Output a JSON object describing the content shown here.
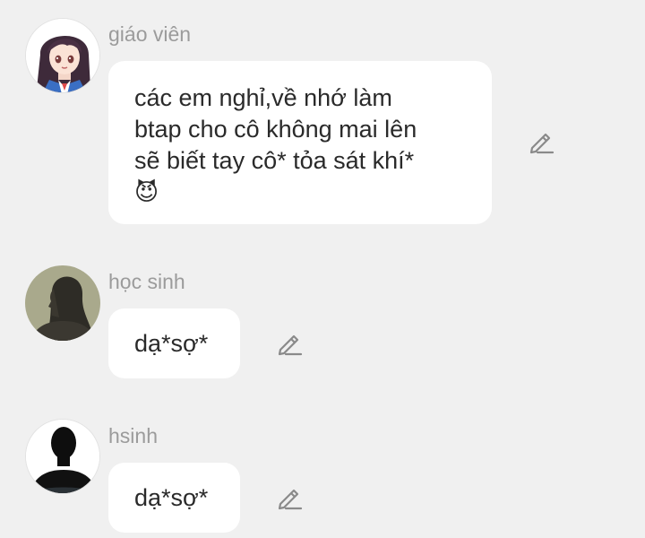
{
  "messages": [
    {
      "sender": "giáo viên",
      "avatar_icon": "anime-girl-avatar-icon",
      "lines": [
        "các em nghỉ,về nhớ làm",
        "btap cho cô không mai lên",
        "sẽ biết tay cô* tỏa sát khí*"
      ],
      "emoji": "😈"
    },
    {
      "sender": "học sinh",
      "avatar_icon": "silhouette-woman-avatar-icon",
      "lines": [
        "dạ*sợ*"
      ]
    },
    {
      "sender": "hsinh",
      "avatar_icon": "silhouette-man-avatar-icon",
      "lines": [
        "dạ*sợ*"
      ]
    }
  ],
  "icons": {
    "edit": "pencil-edit-icon"
  },
  "colors": {
    "background": "#f0f0f0",
    "bubble": "#ffffff",
    "sender_name": "#9b9b9b",
    "message_text": "#2a2a2a",
    "edit_icon": "#8a8a8a"
  }
}
